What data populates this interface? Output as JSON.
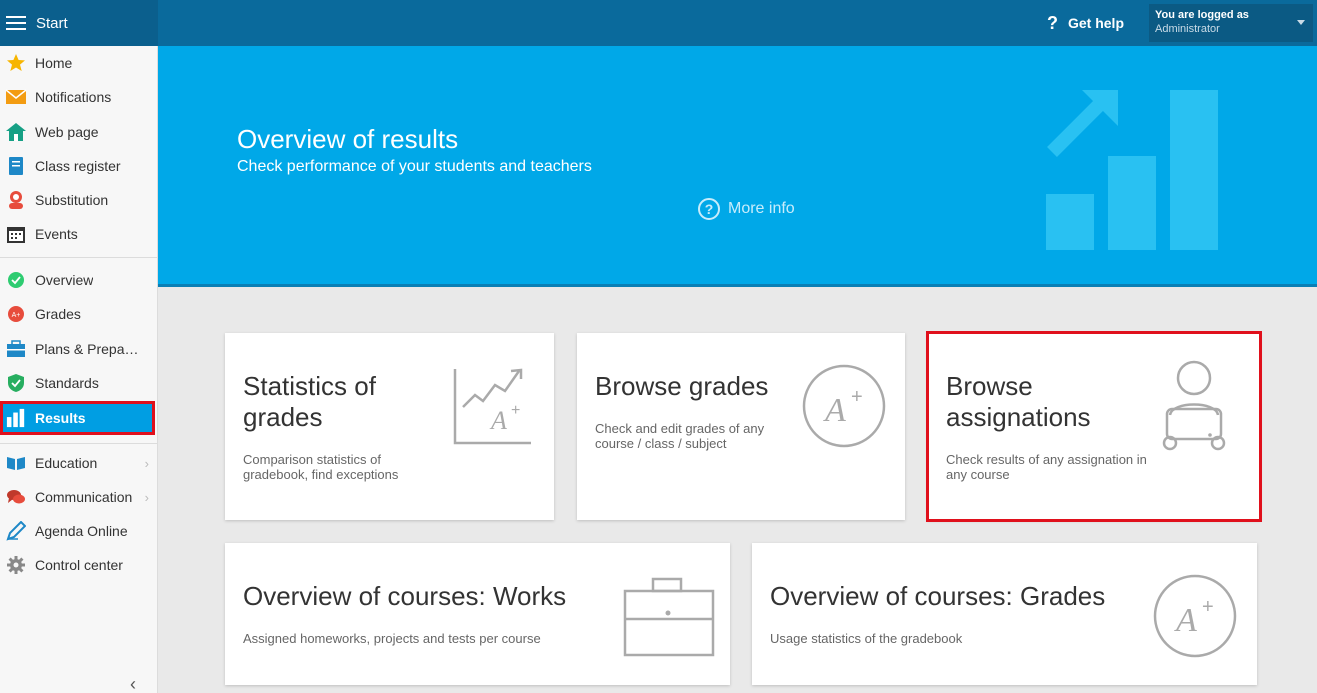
{
  "topbar": {
    "start_label": "Start",
    "help_label": "Get help",
    "help_icon": "question-icon",
    "user_label": "You are logged as",
    "user_name": "Administrator"
  },
  "sidebar": {
    "items": [
      {
        "label": "Home",
        "icon": "star-icon"
      },
      {
        "label": "Notifications",
        "icon": "envelope-icon"
      },
      {
        "label": "Web page",
        "icon": "house-icon"
      },
      {
        "label": "Class register",
        "icon": "book-icon"
      },
      {
        "label": "Substitution",
        "icon": "person-icon"
      },
      {
        "label": "Events",
        "icon": "calendar-icon"
      },
      {
        "label": "Overview",
        "icon": "check-circle-icon"
      },
      {
        "label": "Grades",
        "icon": "grade-circle-icon"
      },
      {
        "label": "Plans & Preparations",
        "icon": "briefcase-icon"
      },
      {
        "label": "Standards",
        "icon": "shield-check-icon"
      },
      {
        "label": "Results",
        "icon": "bar-chart-icon",
        "active": true
      },
      {
        "label": "Education",
        "icon": "open-book-icon"
      },
      {
        "label": "Communication",
        "icon": "chat-icon"
      },
      {
        "label": "Agenda Online",
        "icon": "pencil-icon"
      },
      {
        "label": "Control center",
        "icon": "gear-icon"
      }
    ]
  },
  "banner": {
    "title": "Overview of results",
    "subtitle": "Check performance of your students and teachers",
    "more_info": "More info"
  },
  "cards": [
    {
      "title": "Statistics of grades",
      "desc": "Comparison statistics of gradebook, find exceptions",
      "icon": "grade-trend-icon"
    },
    {
      "title": "Browse grades",
      "desc": "Check and edit grades of any course / class / subject",
      "icon": "a-plus-icon"
    },
    {
      "title": "Browse assignations",
      "desc": "Check results of any assignation in any course",
      "icon": "student-laptop-icon"
    },
    {
      "title": "Overview of courses: Works",
      "desc": "Assigned homeworks, projects and tests per course",
      "icon": "briefcase-icon"
    },
    {
      "title": "Overview of courses: Grades",
      "desc": "Usage statistics of the gradebook",
      "icon": "a-plus-icon"
    }
  ],
  "colors": {
    "topbar": "#0a6a9c",
    "banner": "#00a8e8",
    "active_nav": "#009ee3",
    "highlight": "#e0101c"
  }
}
